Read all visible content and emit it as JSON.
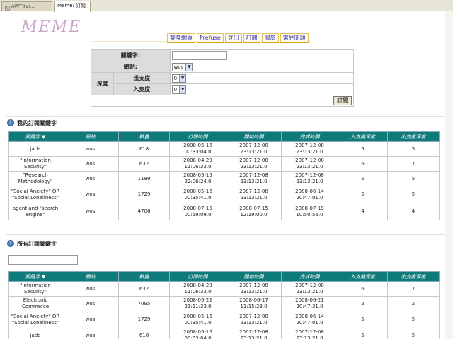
{
  "browser": {
    "tabs": [
      {
        "label": "AWTdvi..."
      },
      {
        "label": "Meme: 訂閱"
      }
    ]
  },
  "logo": {
    "text": "MEME"
  },
  "nav": {
    "items": [
      {
        "label": "雙身網頁"
      },
      {
        "label": "Prefuse"
      },
      {
        "label": "登出"
      },
      {
        "label": "訂閱"
      },
      {
        "label": "關於"
      },
      {
        "label": "常見問題"
      }
    ]
  },
  "form": {
    "keyword_label": "關鍵字:",
    "keyword_value": "",
    "site_label": "網站:",
    "site_value": "wos",
    "depth_label": "深度",
    "out_label": "出支度",
    "out_value": "0",
    "in_label": "入支度",
    "in_value": "0",
    "submit_label": "訂閱"
  },
  "my_section": {
    "title": "我的訂閱關鍵字",
    "columns": [
      "關鍵字 ▼",
      "網站",
      "數量",
      "訂閱時間",
      "開始時間",
      "完成時間",
      "入支度深度",
      "出支度深度"
    ],
    "rows": [
      [
        "jade",
        "wos",
        "618",
        "2008-05-16 00:33:04.0",
        "2007-12-08 23:13:21.0",
        "2007-12-08 23:13:21.0",
        "5",
        "5"
      ],
      [
        "\"Information Security\"",
        "wos",
        "632",
        "2008-04-29 11:06:33.0",
        "2007-12-08 23:13:21.0",
        "2007-12-08 23:13:21.0",
        "6",
        "7"
      ],
      [
        "\"Research Methodology\"",
        "wos",
        "1189",
        "2008-05-15 22:06:24.0",
        "2007-12-08 23:13:21.0",
        "2007-12-08 23:13:21.0",
        "5",
        "5"
      ],
      [
        "\"Social Anxiety\" OR \"Social Loneliness\"",
        "wos",
        "1729",
        "2008-05-16 00:35:41.0",
        "2007-12-08 23:13:21.0",
        "2008-06-14 20:47:01.0",
        "5",
        "5"
      ],
      [
        "agent and \"search engine\"",
        "wos",
        "4706",
        "2008-07-15 00:59:09.0",
        "2008-07-15 12:19:00.0",
        "2008-07-19 10:50:56.0",
        "4",
        "4"
      ]
    ]
  },
  "all_section": {
    "title": "所有訂閱關鍵字",
    "filter_value": "",
    "columns": [
      "關鍵字 ▼",
      "網站",
      "數量",
      "訂閱時間",
      "開始時間",
      "完成時間",
      "入支度深度",
      "出支度深度"
    ],
    "rows": [
      [
        "\"Information Security\"",
        "wos",
        "632",
        "2008-04-29 11:06:33.0",
        "2007-12-08 23:13:21.0",
        "2007-12-08 23:13:21.0",
        "6",
        "7"
      ],
      [
        "Electronic Commerce",
        "wos",
        "7095",
        "2008-05-22 21:11:33.0",
        "2008-06-17 11:15:23.0",
        "2008-06-21 20:47:31.0",
        "2",
        "2"
      ],
      [
        "\"Social Anxiety\" OR \"Social Loneliness\"",
        "wos",
        "1729",
        "2008-05-16 00:35:41.0",
        "2007-12-08 23:13:21.0",
        "2008-06-14 20:47:01.0",
        "5",
        "5"
      ],
      [
        "jade",
        "wos",
        "618",
        "2008-05-16 00:33:04.0",
        "2007-12-08 23:13:21.0",
        "2007-12-08 23:13:21.0",
        "5",
        "5"
      ]
    ]
  }
}
